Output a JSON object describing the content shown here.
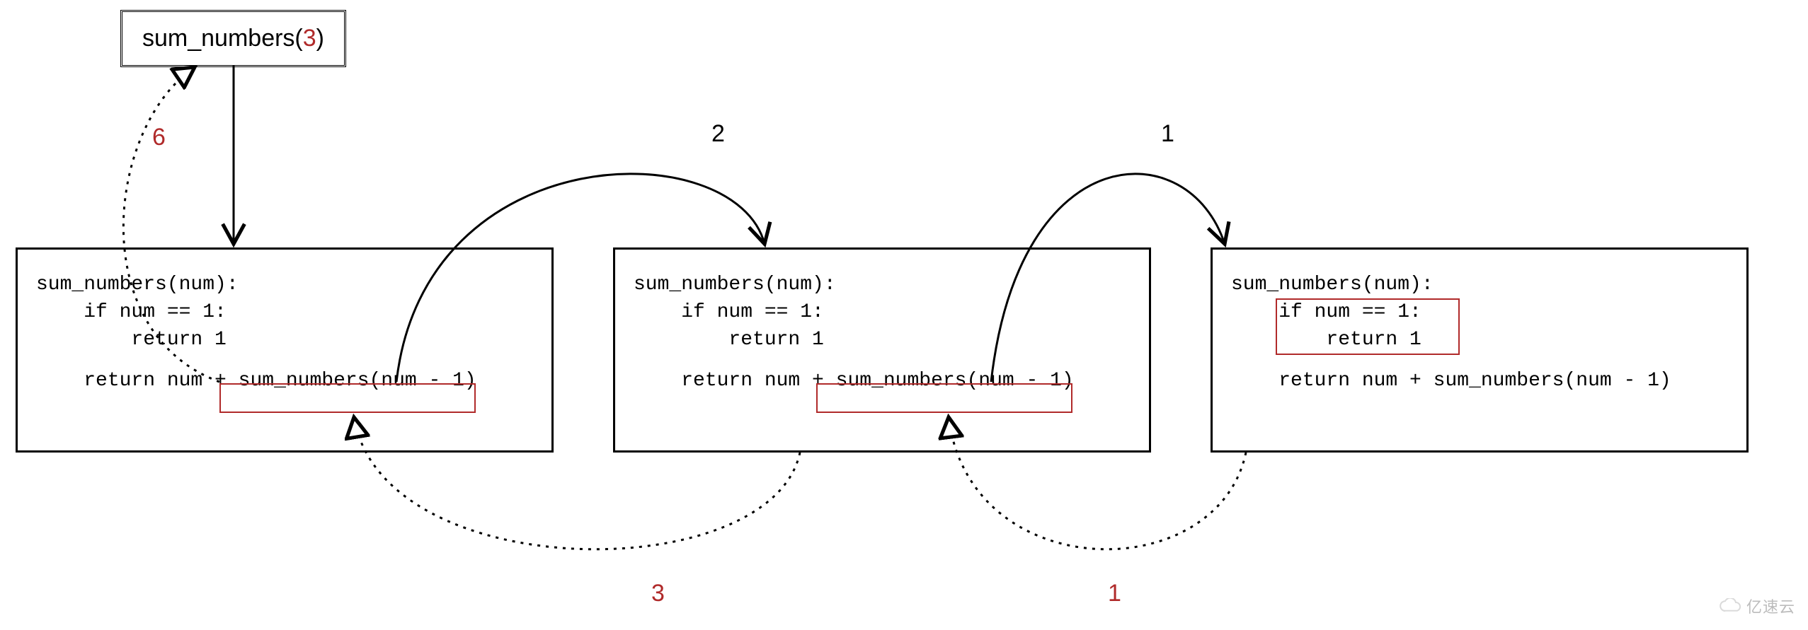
{
  "call": {
    "fn_name": "sum_numbers",
    "arg": "3"
  },
  "forward_labels": {
    "step2": "2",
    "step1": "1"
  },
  "return_labels": {
    "r6": "6",
    "r3": "3",
    "r1": "1"
  },
  "code": {
    "line1": "sum_numbers(num):",
    "line2": "    if num == 1:",
    "line3": "        return 1",
    "line4_prefix": "    return num + ",
    "recursive_call": "sum_numbers(num - 1)"
  },
  "watermark": "亿速云"
}
